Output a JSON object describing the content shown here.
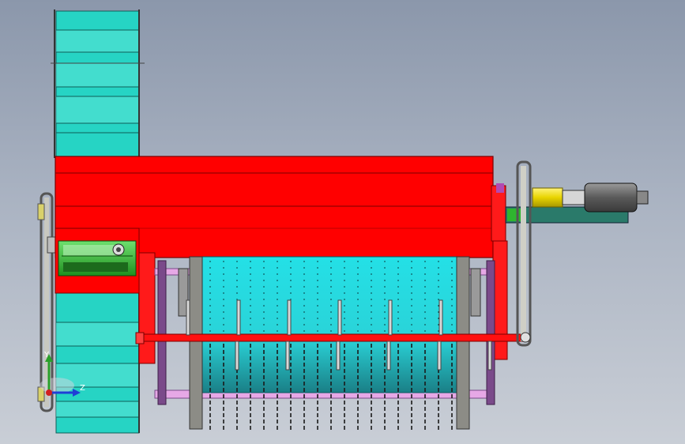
{
  "viewport": {
    "background_top": "#8b97ab",
    "background_bottom": "#c9ced6"
  },
  "colors": {
    "housing_red": "#ff0000",
    "housing_red_dark": "#c40000",
    "chute_cyan": "#26d4c4",
    "chute_cyan_light": "#5fe6d8",
    "drum_cyan": "#1fe3e8",
    "gearbox_green": "#2fb52f",
    "shaft_yellow": "#e8d400",
    "motor_gray": "#6e6e6e",
    "frame_violet": "#7a4a8a",
    "rail_pink": "#e6a8e6",
    "drum_ring_gray": "#8c8c86",
    "axis_y": "#2aa02a",
    "axis_z": "#1f3fd6"
  },
  "drum": {
    "tine_columns": 19,
    "tine_rows_upper": 5,
    "tine_rows_lower": 3,
    "arm_count": 6
  },
  "triad": {
    "y_label": "Y",
    "z_label": "Z",
    "x_label": ""
  }
}
